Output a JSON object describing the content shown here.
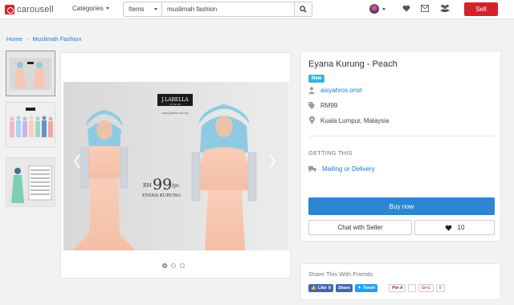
{
  "header": {
    "logo_text": "carousell",
    "categories_label": "Categories",
    "search_type": "Items",
    "search_query": "muslimah fashion",
    "sell_label": "Sell",
    "accent": "#d2232a"
  },
  "breadcrumb": {
    "home": "Home",
    "category": "Muslimah Fashion"
  },
  "gallery": {
    "brand_label": "J.LABELLA",
    "brand_sub": "STYLE LAB",
    "site": "www.jlabella.com.my",
    "price_prefix": "RM",
    "price_value": "99",
    "price_unit": "/pc",
    "product_name": "EYANA KURUNG",
    "slide_count": 3,
    "active_slide": 1
  },
  "listing": {
    "title": "Eyana Kurung - Peach",
    "badge": "New",
    "seller": "aisyahros.onst",
    "price": "RM99",
    "location": "Kuala Lumpur, Malaysia",
    "getting_this_label": "GETTING THIS",
    "delivery": "Mailing or Delivery",
    "buy_label": "Buy now",
    "chat_label": "Chat with Seller",
    "likes": "10",
    "buy_color": "#2d86d3",
    "badge_color": "#39b4d8"
  },
  "share": {
    "title": "Share This With Friends",
    "fb_like": "Like",
    "fb_like_count": "0",
    "fb_share": "Share",
    "tweet": "Tweet",
    "pin": "Pin it",
    "gplus": "G+1",
    "gplus_count": "0"
  }
}
